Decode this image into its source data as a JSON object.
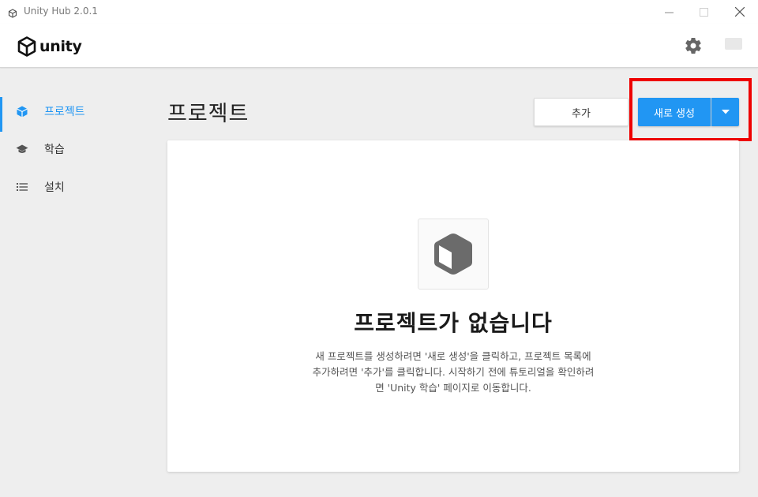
{
  "window": {
    "title": "Unity Hub 2.0.1"
  },
  "header": {
    "logo_text": "unity",
    "settings_icon": "gear-icon",
    "account_icon": "account-icon"
  },
  "sidebar": {
    "items": [
      {
        "label": "프로젝트",
        "icon": "cube-icon",
        "active": true
      },
      {
        "label": "학습",
        "icon": "graduation-cap-icon",
        "active": false
      },
      {
        "label": "설치",
        "icon": "list-icon",
        "active": false
      }
    ]
  },
  "main": {
    "title": "프로젝트",
    "add_label": "추가",
    "new_label": "새로 생성",
    "dropdown_icon": "caret-down-icon",
    "empty": {
      "icon": "cube-icon",
      "title": "프로젝트가 없습니다",
      "line1": "새 프로젝트를 생성하려면 '새로 생성'을 클릭하고, 프로젝트 목록에",
      "line2": "추가하려면 '추가'를 클릭합니다. 시작하기 전에 튜토리얼을 확인하려",
      "line3": "면 'Unity 학습' 페이지로 이동합니다."
    }
  },
  "colors": {
    "accent": "#2196f3",
    "highlight": "#ee0000"
  }
}
